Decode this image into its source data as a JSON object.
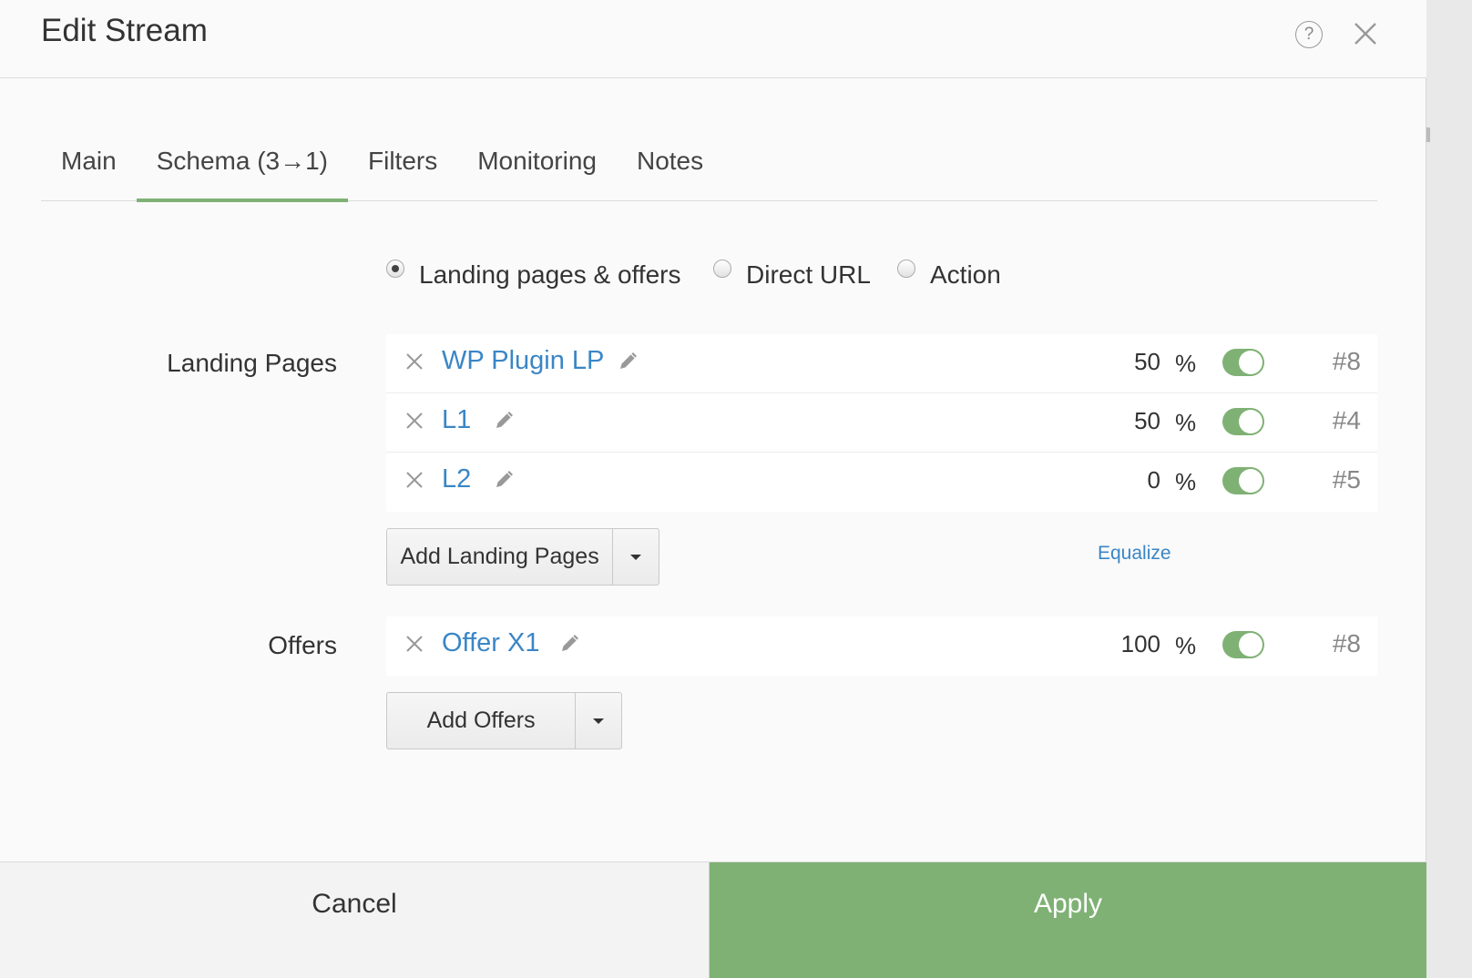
{
  "dialog": {
    "title": "Edit Stream",
    "help_icon": "question-circle-icon",
    "help_glyph": "?",
    "close_icon": "close-icon"
  },
  "tabs": [
    {
      "label": "Main",
      "active": false
    },
    {
      "label": "Schema (3→1)",
      "active": true
    },
    {
      "label": "Filters",
      "active": false
    },
    {
      "label": "Monitoring",
      "active": false
    },
    {
      "label": "Notes",
      "active": false
    }
  ],
  "schema_type": {
    "options": [
      {
        "label": "Landing pages & offers",
        "checked": true
      },
      {
        "label": "Direct URL",
        "checked": false
      },
      {
        "label": "Action",
        "checked": false
      }
    ]
  },
  "landing_pages": {
    "label": "Landing Pages",
    "items": [
      {
        "name": "WP Plugin LP",
        "weight": "50",
        "unit": "%",
        "enabled": true,
        "id": "#8"
      },
      {
        "name": "L1",
        "weight": "50",
        "unit": "%",
        "enabled": true,
        "id": "#4"
      },
      {
        "name": "L2",
        "weight": "0",
        "unit": "%",
        "enabled": true,
        "id": "#5"
      }
    ],
    "add_button": "Add Landing Pages",
    "equalize_label": "Equalize"
  },
  "offers": {
    "label": "Offers",
    "items": [
      {
        "name": "Offer X1",
        "weight": "100",
        "unit": "%",
        "enabled": true,
        "id": "#8"
      }
    ],
    "add_button": "Add Offers"
  },
  "footer": {
    "cancel_label": "Cancel",
    "apply_label": "Apply"
  },
  "colors": {
    "accent_green": "#7fb174",
    "link_blue": "#3a86c6"
  }
}
